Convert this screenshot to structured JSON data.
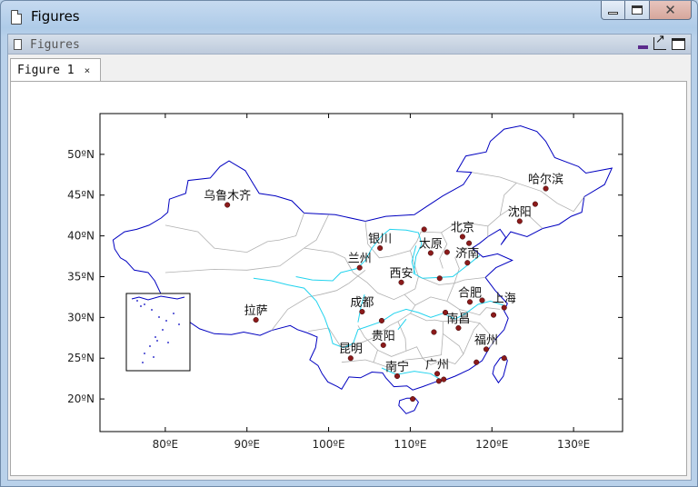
{
  "window": {
    "title": "Figures",
    "buttons": {
      "minimize": "minimize",
      "maximize": "maximize",
      "close": "✕"
    }
  },
  "panel": {
    "title": "Figures"
  },
  "tabs": [
    {
      "label": "Figure 1",
      "close": "×"
    }
  ],
  "map": {
    "x_ticks": [
      "80ºE",
      "90ºE",
      "100ºE",
      "110ºE",
      "120ºE",
      "130ºE"
    ],
    "y_ticks": [
      "50ºN",
      "45ºN",
      "40ºN",
      "35ºN",
      "30ºN",
      "25ºN",
      "20ºN"
    ],
    "cities": [
      {
        "name": "乌鲁木齐",
        "lon": 87.6,
        "lat": 43.8
      },
      {
        "name": "哈尔滨",
        "lon": 126.6,
        "lat": 45.8
      },
      {
        "name": "沈阳",
        "lon": 123.4,
        "lat": 41.8
      },
      {
        "name": "北京",
        "lon": 116.4,
        "lat": 39.9
      },
      {
        "name": "银川",
        "lon": 106.3,
        "lat": 38.5
      },
      {
        "name": "太原",
        "lon": 112.5,
        "lat": 37.9
      },
      {
        "name": "济南",
        "lon": 117.0,
        "lat": 36.7
      },
      {
        "name": "兰州",
        "lon": 103.8,
        "lat": 36.1
      },
      {
        "name": "西安",
        "lon": 108.9,
        "lat": 34.3
      },
      {
        "name": "合肥",
        "lon": 117.3,
        "lat": 31.9
      },
      {
        "name": "上海",
        "lon": 121.5,
        "lat": 31.2
      },
      {
        "name": "成都",
        "lon": 104.1,
        "lat": 30.7
      },
      {
        "name": "拉萨",
        "lon": 91.1,
        "lat": 29.7
      },
      {
        "name": "南昌",
        "lon": 115.9,
        "lat": 28.7
      },
      {
        "name": "贵阳",
        "lon": 106.7,
        "lat": 26.6
      },
      {
        "name": "昆明",
        "lon": 102.7,
        "lat": 25.0
      },
      {
        "name": "福州",
        "lon": 119.3,
        "lat": 26.1
      },
      {
        "name": "南宁",
        "lon": 108.4,
        "lat": 22.8
      },
      {
        "name": "广州",
        "lon": 113.3,
        "lat": 23.1
      }
    ],
    "extra_points": [
      {
        "lon": 111.7,
        "lat": 40.8
      },
      {
        "lon": 117.2,
        "lat": 39.1
      },
      {
        "lon": 114.5,
        "lat": 38.0
      },
      {
        "lon": 113.6,
        "lat": 34.8
      },
      {
        "lon": 114.3,
        "lat": 30.6
      },
      {
        "lon": 112.9,
        "lat": 28.2
      },
      {
        "lon": 106.5,
        "lat": 29.6
      },
      {
        "lon": 118.8,
        "lat": 32.1
      },
      {
        "lon": 120.2,
        "lat": 30.3
      },
      {
        "lon": 125.3,
        "lat": 43.9
      },
      {
        "lon": 110.3,
        "lat": 20.0
      },
      {
        "lon": 114.1,
        "lat": 22.4
      },
      {
        "lon": 113.5,
        "lat": 22.2
      },
      {
        "lon": 121.5,
        "lat": 25.0
      },
      {
        "lon": 118.1,
        "lat": 24.5
      }
    ],
    "colors": {
      "border": "#0000c0",
      "province": "#b0b0b0",
      "river": "#22d3ee",
      "city": "#8b1a1a"
    }
  }
}
